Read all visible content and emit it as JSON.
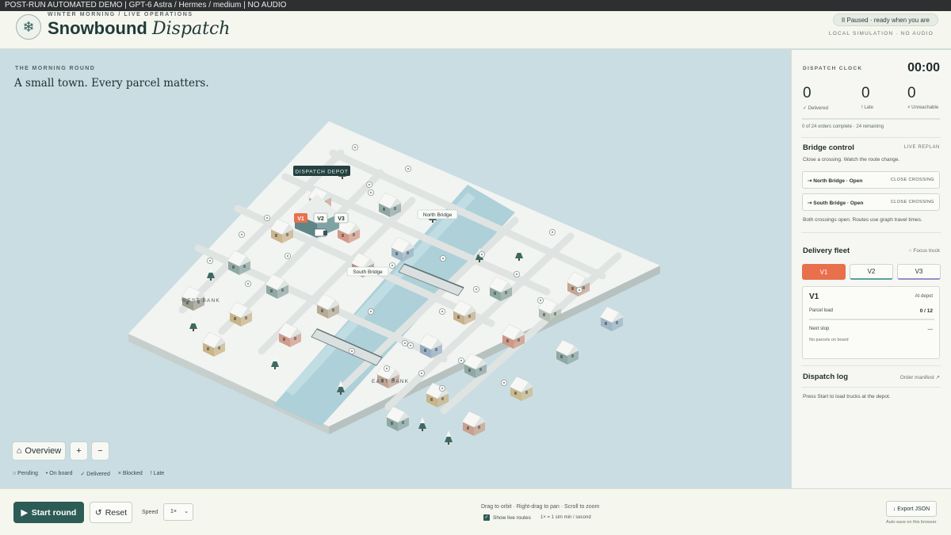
{
  "topbar": {
    "text": "POST-RUN AUTOMATED DEMO | GPT-6 Astra / Hermes / medium | NO AUDIO"
  },
  "header": {
    "eyebrow": "WINTER MORNING / LIVE OPERATIONS",
    "title_main": "Snowbound",
    "title_italic": "Dispatch",
    "logo_icon": "snowflake-icon",
    "status": "II Paused · ready when you are",
    "status_sub": "LOCAL SIMULATION · NO AUDIO"
  },
  "map": {
    "eyebrow": "THE MORNING ROUND",
    "headline": "A small town. Every parcel matters.",
    "labels": {
      "depot": "DISPATCH DEPOT",
      "north_bridge": "North Bridge",
      "south_bridge": "South Bridge",
      "west_bank": "WEST BANK",
      "east_bank": "EAST BANK"
    },
    "trucks": [
      "V1",
      "V2",
      "V3"
    ],
    "controls": {
      "overview": "Overview",
      "zoom_in": "+",
      "zoom_out": "−"
    },
    "legend": [
      "○ Pending",
      "• On board",
      "✓ Delivered",
      "× Blocked",
      "! Late"
    ],
    "colors": {
      "snow": "#f3f5f2",
      "river": "#a9cdd6",
      "ice": "#bfdde3",
      "active_truck": "#e8704c"
    }
  },
  "sidebar": {
    "clock_label": "DISPATCH CLOCK",
    "clock_time": "00:00",
    "stats": [
      {
        "value": "0",
        "label": "✓ Delivered"
      },
      {
        "value": "0",
        "label": "! Late"
      },
      {
        "value": "0",
        "label": "× Unreachable"
      }
    ],
    "progress_fraction": 0,
    "orders_text": "0 of 24 orders complete · 24 remaining",
    "bridge": {
      "title": "Bridge control",
      "aside": "LIVE REPLAN",
      "desc": "Close a crossing. Watch the route change.",
      "rows": [
        {
          "name": "⇢ North Bridge · Open",
          "action": "CLOSE CROSSING"
        },
        {
          "name": "⇢ South Bridge · Open",
          "action": "CLOSE CROSSING"
        }
      ],
      "note": "Both crossings open. Routes use graph travel times."
    },
    "fleet": {
      "title": "Delivery fleet",
      "focus": "Focus truck",
      "tabs": [
        "V1",
        "V2",
        "V3"
      ],
      "card": {
        "id": "V1",
        "status": "At depot",
        "load_label": "Parcel load",
        "load_value": "0 / 12",
        "load_fraction": 0,
        "next_label": "Next stop",
        "next_value": "—",
        "note": "No parcels on board"
      }
    },
    "log": {
      "title": "Dispatch log",
      "link": "Order manifest ↗",
      "text": "Press Start to load trucks at the depot."
    }
  },
  "bottom": {
    "start": "Start round",
    "reset": "Reset",
    "speed_label": "Speed",
    "speed_value": "1×",
    "hint": "Drag to orbit · Right-drag to pan · Scroll to zoom",
    "routes_label": "Show live routes",
    "rate": "1× = 1 sim min / second",
    "export": "↓ Export JSON",
    "autosave": "Auto-save on this browser"
  }
}
